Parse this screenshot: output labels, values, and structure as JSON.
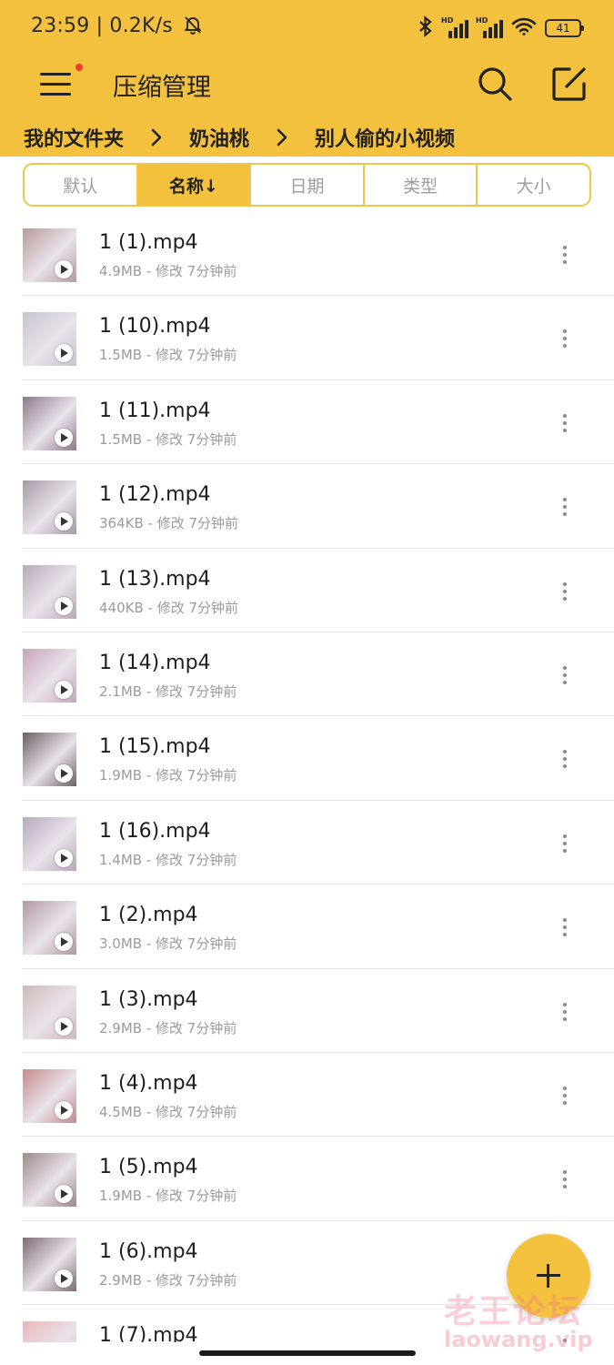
{
  "status_bar": {
    "time_speed": "23:59 | 0.2K/s",
    "signal_1_label": "HD",
    "signal_2_label": "HD",
    "battery": "41"
  },
  "toolbar": {
    "title": "压缩管理"
  },
  "breadcrumb": [
    "我的文件夹",
    "奶油桃",
    "别人偷的小视频"
  ],
  "sort_tabs": [
    {
      "label": "默认",
      "active": false
    },
    {
      "label": "名称↓",
      "active": true
    },
    {
      "label": "日期",
      "active": false
    },
    {
      "label": "类型",
      "active": false
    },
    {
      "label": "大小",
      "active": false
    }
  ],
  "files": [
    {
      "name": "1 (1).mp4",
      "meta": "4.9MB - 修改 7分钟前",
      "thumb_color": "#b79b9a"
    },
    {
      "name": "1 (10).mp4",
      "meta": "1.5MB - 修改 7分钟前",
      "thumb_color": "#c9c3cf"
    },
    {
      "name": "1 (11).mp4",
      "meta": "1.5MB - 修改 7分钟前",
      "thumb_color": "#8e7a8c"
    },
    {
      "name": "1 (12).mp4",
      "meta": "364KB - 修改 7分钟前",
      "thumb_color": "#a59aa6"
    },
    {
      "name": "1 (13).mp4",
      "meta": "440KB - 修改 7分钟前",
      "thumb_color": "#b7aab8"
    },
    {
      "name": "1 (14).mp4",
      "meta": "2.1MB - 修改 7分钟前",
      "thumb_color": "#c7a5bb"
    },
    {
      "name": "1 (15).mp4",
      "meta": "1.9MB - 修改 7分钟前",
      "thumb_color": "#6d5f66"
    },
    {
      "name": "1 (16).mp4",
      "meta": "1.4MB - 修改 7分钟前",
      "thumb_color": "#b9a9bf"
    },
    {
      "name": "1 (2).mp4",
      "meta": "3.0MB - 修改 7分钟前",
      "thumb_color": "#b09aa2"
    },
    {
      "name": "1 (3).mp4",
      "meta": "2.9MB - 修改 7分钟前",
      "thumb_color": "#cdbbb9"
    },
    {
      "name": "1 (4).mp4",
      "meta": "4.5MB - 修改 7分钟前",
      "thumb_color": "#c58c8c"
    },
    {
      "name": "1 (5).mp4",
      "meta": "1.9MB - 修改 7分钟前",
      "thumb_color": "#9c8a8a"
    },
    {
      "name": "1 (6).mp4",
      "meta": "2.9MB - 修改 7分钟前",
      "thumb_color": "#7f6d74"
    },
    {
      "name": "1 (7).mp4",
      "meta": "",
      "thumb_color": "#e7b9bb"
    }
  ],
  "watermark": {
    "cn": "老王论坛",
    "url": "laowang.vip"
  },
  "colors": {
    "accent": "#f3c13e",
    "notification_dot": "#ef3b2c"
  }
}
